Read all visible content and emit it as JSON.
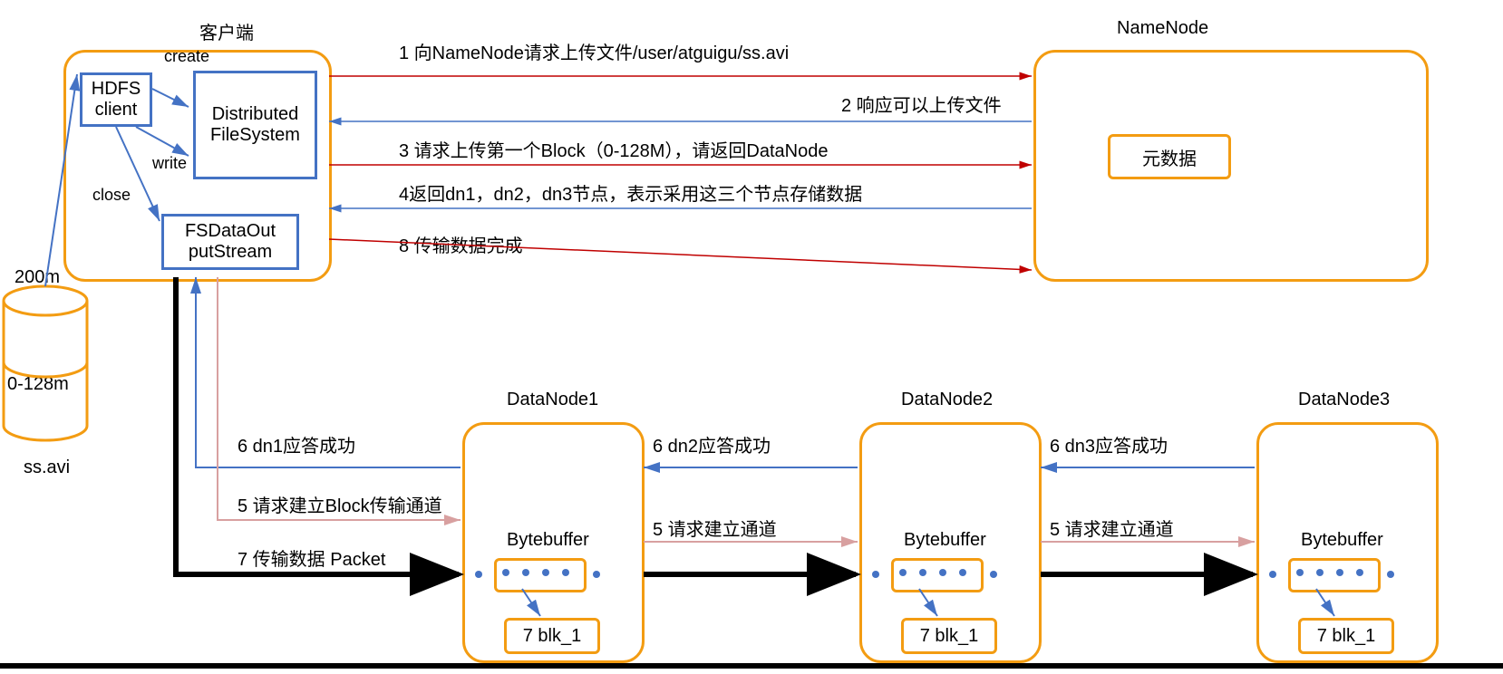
{
  "titles": {
    "client": "客户端",
    "namenode": "NameNode",
    "dn1": "DataNode1",
    "dn2": "DataNode2",
    "dn3": "DataNode3"
  },
  "clientBoxes": {
    "hdfs": "HDFS\nclient",
    "dfs": "Distributed FileSystem",
    "fsout": "FSDataOut\nputStream",
    "create": "create",
    "write": "write",
    "close": "close"
  },
  "namenodeInner": "元数据",
  "file": {
    "size": "200m",
    "block": "0-128m",
    "name": "ss.avi"
  },
  "steps": {
    "s1": "1 向NameNode请求上传文件/user/atguigu/ss.avi",
    "s2": "2 响应可以上传文件",
    "s3": "3 请求上传第一个Block（0-128M），请返回DataNode",
    "s4": "4返回dn1，dn2，dn3节点，表示采用这三个节点存储数据",
    "s5a": "5 请求建立Block传输通道",
    "s5b": "5 请求建立通道",
    "s5c": "5 请求建立通道",
    "s6a": "6 dn1应答成功",
    "s6b": "6 dn2应答成功",
    "s6c": "6 dn3应答成功",
    "s7": "7 传输数据  Packet",
    "s8": "8 传输数据完成"
  },
  "dnInner": {
    "buf": "Bytebuffer",
    "blk": "7 blk_1"
  }
}
